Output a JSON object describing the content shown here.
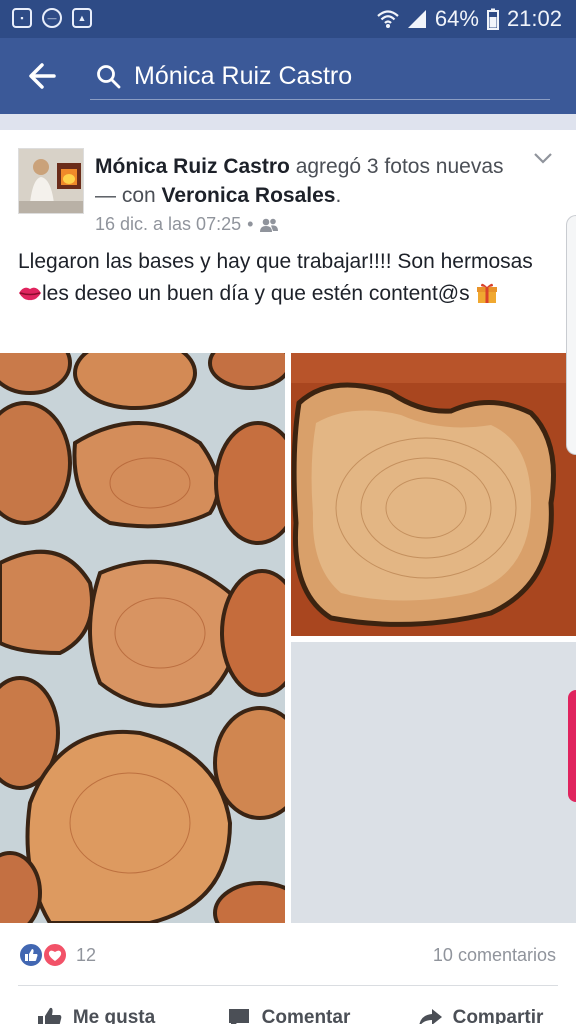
{
  "status_bar": {
    "battery": "64%",
    "time": "21:02",
    "icons": [
      "app-notification-icon",
      "minus-circle-icon",
      "image-icon",
      "wifi-icon",
      "signal-icon",
      "battery-icon"
    ]
  },
  "app_bar": {
    "back_icon": "arrow-left-icon",
    "search_icon": "search-icon",
    "search_text": "Mónica Ruiz Castro"
  },
  "post": {
    "author": "Mónica Ruiz Castro",
    "action_text": " agregó 3 fotos nuevas — con ",
    "tagged": "Veronica Rosales",
    "period": ".",
    "timestamp": "16 dic. a las 07:25",
    "separator": "•",
    "audience_icon": "friends-icon",
    "text_part1": "Llegaron las bases y hay que trabajar!!!! Son hermosas ",
    "text_part2": "les deseo un buen día y que estén content@s ",
    "emoji1": "lips-icon",
    "emoji2": "gift-icon"
  },
  "stats": {
    "reactions_count": "12",
    "comments": "10 comentarios"
  },
  "actions": {
    "like": "Me gusta",
    "comment": "Comentar",
    "share": "Compartir"
  },
  "colors": {
    "facebook_blue": "#3b5998",
    "status_bar": "#2e4b86",
    "like_blue": "#4267b2",
    "love_red": "#f25268"
  }
}
